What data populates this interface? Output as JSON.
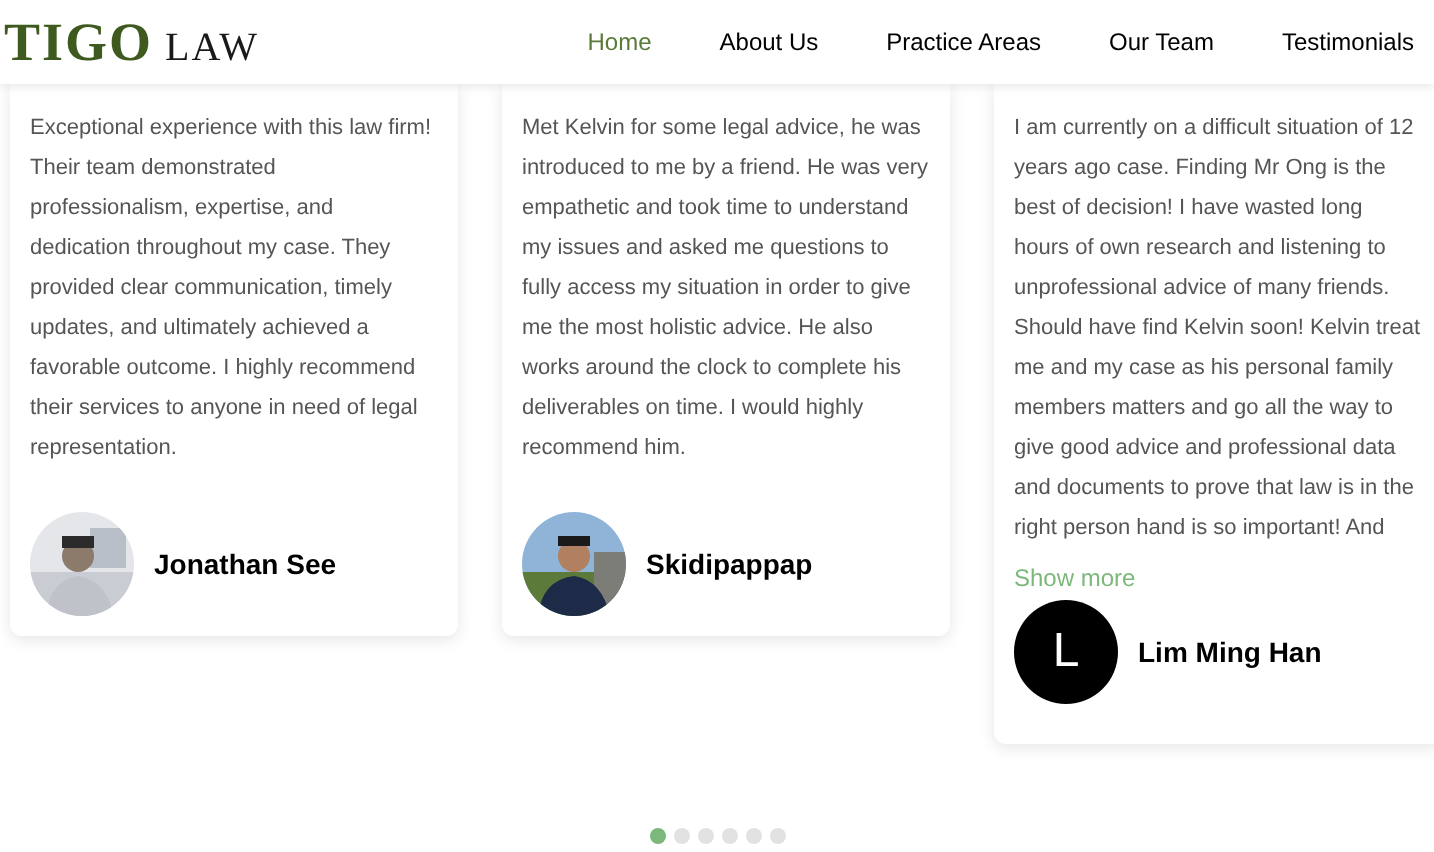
{
  "header": {
    "logo": {
      "main": "TIGO",
      "suffix": "LAW"
    },
    "nav": [
      {
        "label": "Home",
        "selected": true
      },
      {
        "label": "About Us",
        "selected": false
      },
      {
        "label": "Practice Areas",
        "selected": false
      },
      {
        "label": "Our Team",
        "selected": false
      },
      {
        "label": "Testimonials",
        "selected": false
      }
    ]
  },
  "testimonials": [
    {
      "text": "Exceptional experience with this law firm! Their team demonstrated professionalism, expertise, and dedication throughout my case. They provided clear communication, timely updates, and ultimately achieved a favorable outcome. I highly recommend their services to anyone in need of legal representation.",
      "name": "Jonathan See"
    },
    {
      "text": "Met Kelvin for some legal advice, he was introduced to me by a friend. He was very empathetic and took time to understand my issues and asked me questions to fully access my situation in order to give me the most holistic advice. He also works around the clock to complete his deliverables on time. I would highly recommend him.",
      "name": "Skidipappap"
    },
    {
      "text": "I am currently on a difficult situation of 12 years ago case. Finding Mr Ong is the best of decision! I have wasted long hours of own research and listening to unprofessional advice of many friends. Should have find Kelvin soon! Kelvin treat me and my case as his personal family members matters and go all the way to give good advice and professional data and documents to prove that law is in the right person hand is so important! And",
      "name": "Lim Ming Han",
      "show_more": "Show more",
      "avatar": {
        "kind": "initial",
        "letter": "L"
      }
    }
  ],
  "pagination": [
    {
      "selected": true
    },
    {
      "selected": false
    },
    {
      "selected": false
    },
    {
      "selected": false
    },
    {
      "selected": false
    },
    {
      "selected": false
    }
  ]
}
